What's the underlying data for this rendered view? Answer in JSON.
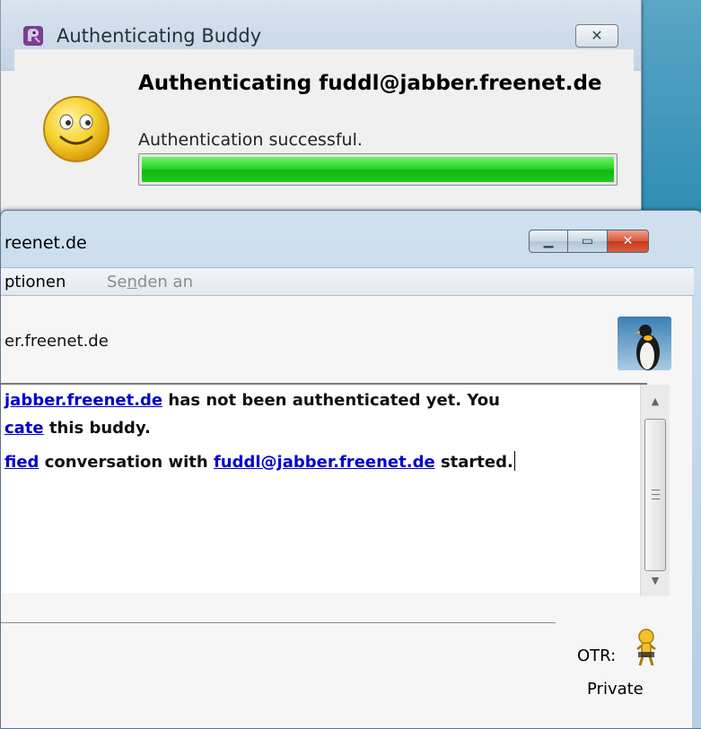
{
  "dialog": {
    "title": "Authenticating Buddy",
    "close_label": "✕",
    "heading": "Authenticating fuddl@jabber.freenet.de",
    "status": "Authentication successful.",
    "progress": 1.0
  },
  "chat": {
    "window_title": "reenet.de",
    "buttons": {
      "minimize": "▁",
      "maximize": "▭",
      "close": "✕"
    },
    "menu": {
      "options": "ptionen",
      "send_pre": "Se",
      "send_u": "n",
      "send_post": "den an"
    },
    "buddy_name": "er.freenet.de",
    "messages": {
      "line1_link": "jabber.freenet.de",
      "line1_text": " has not been authenticated yet.  You",
      "line2_link": "cate",
      "line2_text": " this buddy.",
      "line3_link": "fied",
      "line3_text1": " conversation with ",
      "line3_link2": "fuddl@jabber.freenet.de",
      "line3_text2": " started."
    },
    "otr": {
      "label": "OTR:",
      "status": "Private"
    }
  },
  "colors": {
    "link": "#0000cc",
    "progress": "#2ad42a",
    "close_red": "#c43b1e"
  }
}
